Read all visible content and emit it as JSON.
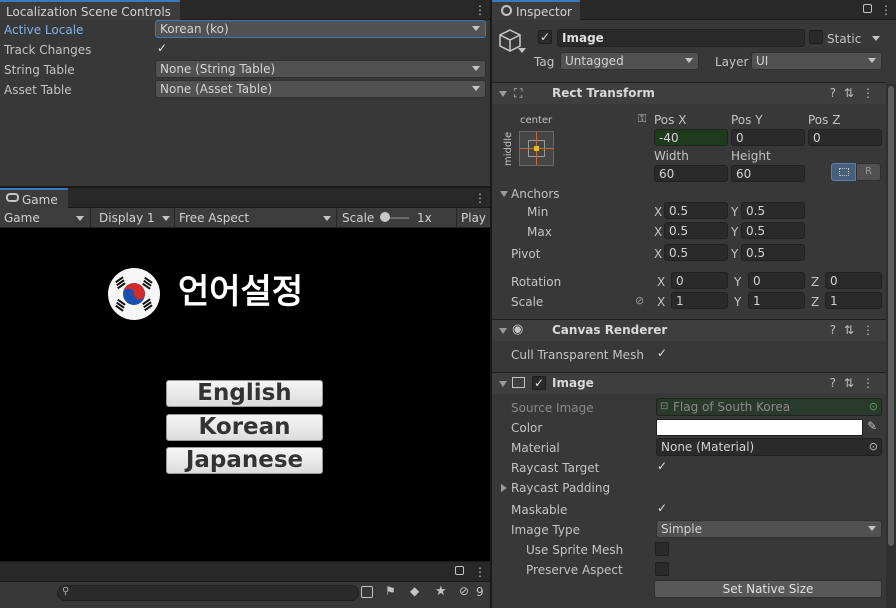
{
  "loc_panel": {
    "tab": "Localization Scene Controls",
    "rows": [
      {
        "label": "Active Locale",
        "value": "Korean (ko)"
      },
      {
        "label": "Track Changes",
        "checked": true
      },
      {
        "label": "String Table",
        "value": "None (String Table)"
      },
      {
        "label": "Asset Table",
        "value": "None (Asset Table)"
      }
    ]
  },
  "game_panel": {
    "tab": "Game",
    "toolbar": {
      "display_mode": "Game",
      "display": "Display 1",
      "aspect": "Free Aspect",
      "scale_label": "Scale",
      "scale_value": "1x",
      "play_label": "Play"
    },
    "title": "언어설정",
    "buttons": [
      "English",
      "Korean",
      "Japanese"
    ]
  },
  "bottom_bar": {
    "badge_count": "9"
  },
  "inspector": {
    "tab": "Inspector",
    "object": {
      "name": "Image",
      "static_label": "Static",
      "tag_label": "Tag",
      "tag_value": "Untagged",
      "layer_label": "Layer",
      "layer_value": "UI"
    },
    "rect_transform": {
      "title": "Rect Transform",
      "anchor_h": "center",
      "anchor_v": "middle",
      "pos_x_label": "Pos X",
      "pos_x": "-40",
      "pos_y_label": "Pos Y",
      "pos_y": "0",
      "pos_z_label": "Pos Z",
      "pos_z": "0",
      "width_label": "Width",
      "width": "60",
      "height_label": "Height",
      "height": "60",
      "r_label": "R",
      "anchors_label": "Anchors",
      "min_label": "Min",
      "min_x": "0.5",
      "min_y": "0.5",
      "max_label": "Max",
      "max_x": "0.5",
      "max_y": "0.5",
      "pivot_label": "Pivot",
      "pivot_x": "0.5",
      "pivot_y": "0.5",
      "rotation_label": "Rotation",
      "rot_x": "0",
      "rot_y": "0",
      "rot_z": "0",
      "scale_label": "Scale",
      "scale_x": "1",
      "scale_y": "1",
      "scale_z": "1",
      "x": "X",
      "y": "Y",
      "z": "Z"
    },
    "canvas_renderer": {
      "title": "Canvas Renderer",
      "cull_label": "Cull Transparent Mesh",
      "cull_checked": true
    },
    "image": {
      "title": "Image",
      "source_label": "Source Image",
      "source_value": "Flag of South Korea",
      "color_label": "Color",
      "color_value": "#ffffff",
      "material_label": "Material",
      "material_value": "None (Material)",
      "raycast_target_label": "Raycast Target",
      "raycast_padding_label": "Raycast Padding",
      "maskable_label": "Maskable",
      "image_type_label": "Image Type",
      "image_type_value": "Simple",
      "use_sprite_mesh_label": "Use Sprite Mesh",
      "preserve_aspect_label": "Preserve Aspect",
      "set_native_size_label": "Set Native Size"
    }
  },
  "colors": {
    "accent": "#3a79bb",
    "posx_field": "#1e3b1e",
    "source_field": "#2a3a2a"
  }
}
